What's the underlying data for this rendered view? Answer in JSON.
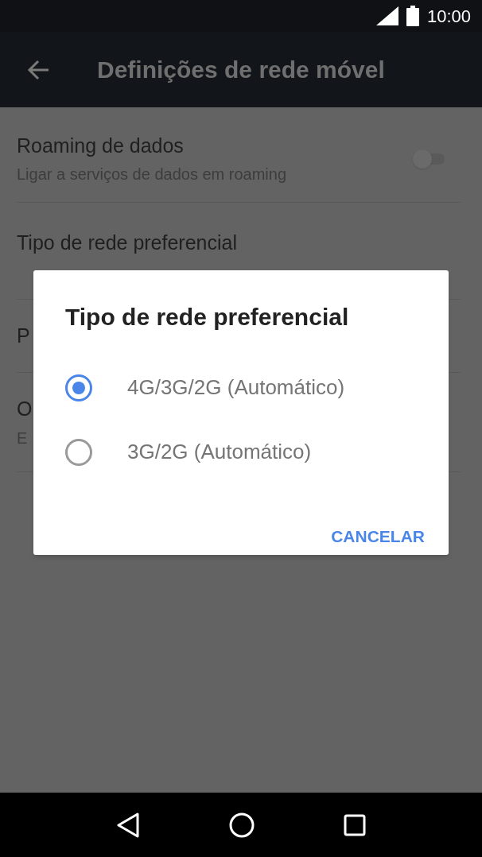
{
  "status_bar": {
    "time": "10:00"
  },
  "app_bar": {
    "title": "Definições de rede móvel"
  },
  "settings": [
    {
      "kind": "switch",
      "title": "Roaming de dados",
      "subtitle": "Ligar a serviços de dados em roaming",
      "on": false
    },
    {
      "kind": "plain",
      "title": "Tipo de rede preferencial"
    },
    {
      "kind": "plain",
      "title": "P"
    },
    {
      "kind": "plain",
      "title": "O",
      "subtitle": "E"
    }
  ],
  "dialog": {
    "title": "Tipo de rede preferencial",
    "options": [
      {
        "label": "4G/3G/2G (Automático)",
        "selected": true
      },
      {
        "label": "3G/2G (Automático)",
        "selected": false
      }
    ],
    "button": "CANCELAR"
  }
}
